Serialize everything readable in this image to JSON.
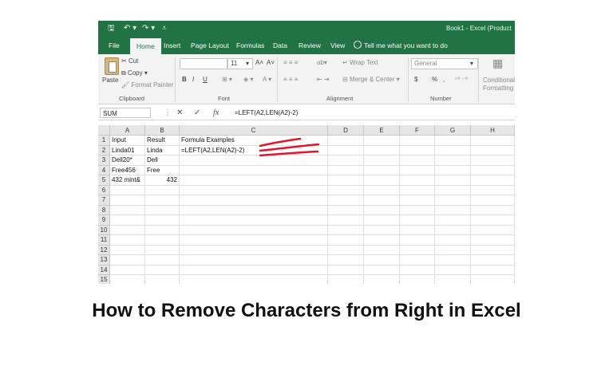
{
  "window": {
    "doc_title": "Book1 - Excel (Product",
    "qa_save": "🖫",
    "qa_undo": "↶ ▾",
    "qa_redo": "↷ ▾",
    "qa_more": "⩡"
  },
  "tabs": [
    "File",
    "Home",
    "Insert",
    "Page Layout",
    "Formulas",
    "Data",
    "Review",
    "View"
  ],
  "tell_me": "Tell me what you want to do",
  "ribbon": {
    "paste": "Paste",
    "cut": "Cut",
    "copy": "Copy",
    "format_painter": "Format Painter",
    "clipboard": "Clipboard",
    "font_size": "11",
    "grow_font": "A˄",
    "shrink_font": "A˅",
    "bold": "B",
    "italic": "I",
    "underline": "U",
    "font_group": "Font",
    "wrap_text": "Wrap Text",
    "merge_center": "Merge & Center",
    "alignment_group": "Alignment",
    "number_format": "General",
    "currency": "$",
    "percent": "%",
    "comma": ",",
    "number_group": "Number",
    "conditional_1": "Conditional",
    "conditional_2": "Formatting"
  },
  "formula_bar": {
    "name_box": "SUM",
    "cancel": "✕",
    "enter": "✓",
    "fx": "fx",
    "formula": "=LEFT(A2,LEN(A2)-2)"
  },
  "columns": [
    "A",
    "B",
    "C",
    "D",
    "E",
    "F",
    "G",
    "H"
  ],
  "rows": [
    "1",
    "2",
    "3",
    "4",
    "5",
    "6",
    "7",
    "8",
    "9",
    "10",
    "11",
    "12",
    "13",
    "14",
    "15"
  ],
  "cells": {
    "A1": "Input",
    "B1": "Result",
    "C1": "Formula Examples",
    "A2": "Linda01",
    "B2": "Linda",
    "C2": "=LEFT(A2,LEN(A2)-2)",
    "A3": "Dell20*",
    "B3": "Dell",
    "A4": "Free456",
    "B4": "Free",
    "A5": "432 mint&",
    "B5": "432"
  },
  "annotation_color": "#e0162b",
  "caption": "How to Remove Characters from Right in Excel"
}
